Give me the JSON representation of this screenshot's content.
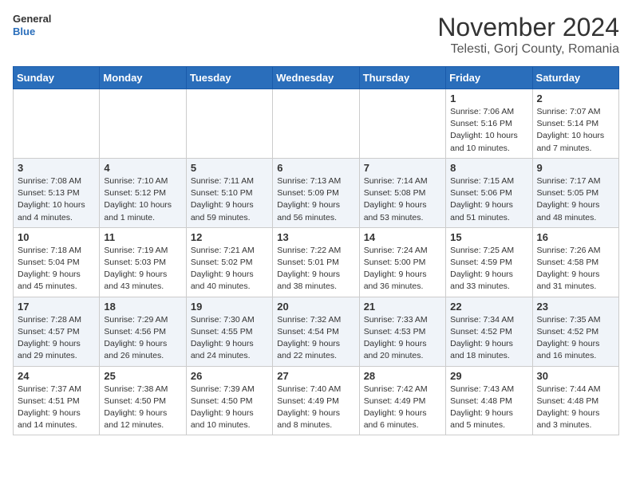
{
  "logo": {
    "line1": "General",
    "line2": "Blue"
  },
  "title": "November 2024",
  "subtitle": "Telesti, Gorj County, Romania",
  "days_of_week": [
    "Sunday",
    "Monday",
    "Tuesday",
    "Wednesday",
    "Thursday",
    "Friday",
    "Saturday"
  ],
  "weeks": [
    [
      {
        "day": "",
        "info": ""
      },
      {
        "day": "",
        "info": ""
      },
      {
        "day": "",
        "info": ""
      },
      {
        "day": "",
        "info": ""
      },
      {
        "day": "",
        "info": ""
      },
      {
        "day": "1",
        "info": "Sunrise: 7:06 AM\nSunset: 5:16 PM\nDaylight: 10 hours and 10 minutes."
      },
      {
        "day": "2",
        "info": "Sunrise: 7:07 AM\nSunset: 5:14 PM\nDaylight: 10 hours and 7 minutes."
      }
    ],
    [
      {
        "day": "3",
        "info": "Sunrise: 7:08 AM\nSunset: 5:13 PM\nDaylight: 10 hours and 4 minutes."
      },
      {
        "day": "4",
        "info": "Sunrise: 7:10 AM\nSunset: 5:12 PM\nDaylight: 10 hours and 1 minute."
      },
      {
        "day": "5",
        "info": "Sunrise: 7:11 AM\nSunset: 5:10 PM\nDaylight: 9 hours and 59 minutes."
      },
      {
        "day": "6",
        "info": "Sunrise: 7:13 AM\nSunset: 5:09 PM\nDaylight: 9 hours and 56 minutes."
      },
      {
        "day": "7",
        "info": "Sunrise: 7:14 AM\nSunset: 5:08 PM\nDaylight: 9 hours and 53 minutes."
      },
      {
        "day": "8",
        "info": "Sunrise: 7:15 AM\nSunset: 5:06 PM\nDaylight: 9 hours and 51 minutes."
      },
      {
        "day": "9",
        "info": "Sunrise: 7:17 AM\nSunset: 5:05 PM\nDaylight: 9 hours and 48 minutes."
      }
    ],
    [
      {
        "day": "10",
        "info": "Sunrise: 7:18 AM\nSunset: 5:04 PM\nDaylight: 9 hours and 45 minutes."
      },
      {
        "day": "11",
        "info": "Sunrise: 7:19 AM\nSunset: 5:03 PM\nDaylight: 9 hours and 43 minutes."
      },
      {
        "day": "12",
        "info": "Sunrise: 7:21 AM\nSunset: 5:02 PM\nDaylight: 9 hours and 40 minutes."
      },
      {
        "day": "13",
        "info": "Sunrise: 7:22 AM\nSunset: 5:01 PM\nDaylight: 9 hours and 38 minutes."
      },
      {
        "day": "14",
        "info": "Sunrise: 7:24 AM\nSunset: 5:00 PM\nDaylight: 9 hours and 36 minutes."
      },
      {
        "day": "15",
        "info": "Sunrise: 7:25 AM\nSunset: 4:59 PM\nDaylight: 9 hours and 33 minutes."
      },
      {
        "day": "16",
        "info": "Sunrise: 7:26 AM\nSunset: 4:58 PM\nDaylight: 9 hours and 31 minutes."
      }
    ],
    [
      {
        "day": "17",
        "info": "Sunrise: 7:28 AM\nSunset: 4:57 PM\nDaylight: 9 hours and 29 minutes."
      },
      {
        "day": "18",
        "info": "Sunrise: 7:29 AM\nSunset: 4:56 PM\nDaylight: 9 hours and 26 minutes."
      },
      {
        "day": "19",
        "info": "Sunrise: 7:30 AM\nSunset: 4:55 PM\nDaylight: 9 hours and 24 minutes."
      },
      {
        "day": "20",
        "info": "Sunrise: 7:32 AM\nSunset: 4:54 PM\nDaylight: 9 hours and 22 minutes."
      },
      {
        "day": "21",
        "info": "Sunrise: 7:33 AM\nSunset: 4:53 PM\nDaylight: 9 hours and 20 minutes."
      },
      {
        "day": "22",
        "info": "Sunrise: 7:34 AM\nSunset: 4:52 PM\nDaylight: 9 hours and 18 minutes."
      },
      {
        "day": "23",
        "info": "Sunrise: 7:35 AM\nSunset: 4:52 PM\nDaylight: 9 hours and 16 minutes."
      }
    ],
    [
      {
        "day": "24",
        "info": "Sunrise: 7:37 AM\nSunset: 4:51 PM\nDaylight: 9 hours and 14 minutes."
      },
      {
        "day": "25",
        "info": "Sunrise: 7:38 AM\nSunset: 4:50 PM\nDaylight: 9 hours and 12 minutes."
      },
      {
        "day": "26",
        "info": "Sunrise: 7:39 AM\nSunset: 4:50 PM\nDaylight: 9 hours and 10 minutes."
      },
      {
        "day": "27",
        "info": "Sunrise: 7:40 AM\nSunset: 4:49 PM\nDaylight: 9 hours and 8 minutes."
      },
      {
        "day": "28",
        "info": "Sunrise: 7:42 AM\nSunset: 4:49 PM\nDaylight: 9 hours and 6 minutes."
      },
      {
        "day": "29",
        "info": "Sunrise: 7:43 AM\nSunset: 4:48 PM\nDaylight: 9 hours and 5 minutes."
      },
      {
        "day": "30",
        "info": "Sunrise: 7:44 AM\nSunset: 4:48 PM\nDaylight: 9 hours and 3 minutes."
      }
    ]
  ]
}
